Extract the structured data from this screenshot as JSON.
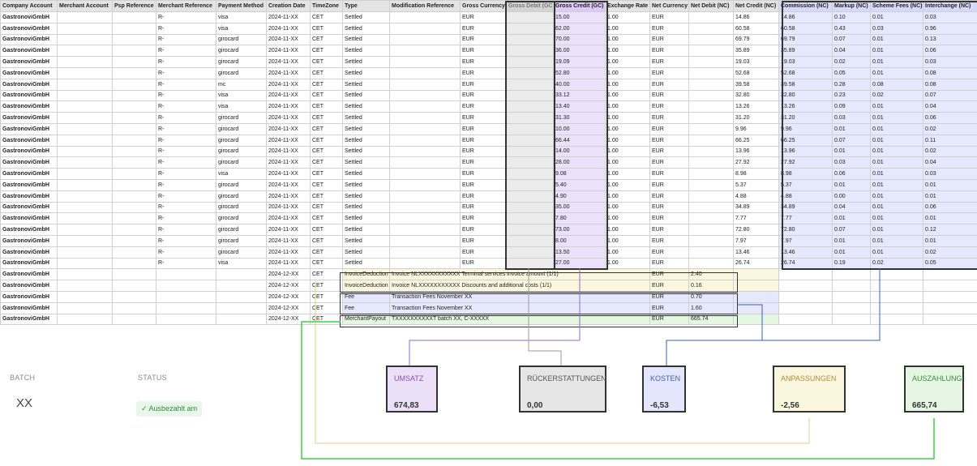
{
  "columns": [
    "Company Account",
    "Merchant Account",
    "Psp Reference",
    "Merchant Reference",
    "Payment Method",
    "Creation Date",
    "TimeZone",
    "Type",
    "Modification Reference",
    "Gross Currency",
    "Gross Debit (GC)",
    "Gross Credit (GC)",
    "Exchange Rate",
    "Net Currency",
    "Net Debit (NC)",
    "Net Credit (NC)",
    "Commission (NC)",
    "Markup (NC)",
    "Scheme Fees (NC)",
    "Interchange (NC)"
  ],
  "settled_rows": [
    [
      "GastronoviGmbH",
      "",
      "",
      "R-",
      "visa",
      "2024-11-XX",
      "CET",
      "Settled",
      "",
      "EUR",
      "",
      "15.00",
      "1.00",
      "EUR",
      "",
      "14.86",
      "0.10",
      "0.01",
      "0.03"
    ],
    [
      "GastronoviGmbH",
      "",
      "",
      "R-",
      "visa",
      "2024-11-XX",
      "CET",
      "Settled",
      "",
      "EUR",
      "",
      "62.00",
      "1.00",
      "EUR",
      "",
      "60.58",
      "0.43",
      "0.03",
      "0.96"
    ],
    [
      "GastronoviGmbH",
      "",
      "",
      "R-",
      "girocard",
      "2024-11-XX",
      "CET",
      "Settled",
      "",
      "EUR",
      "",
      "70.00",
      "1.00",
      "EUR",
      "",
      "69.79",
      "0.07",
      "0.01",
      "0.13"
    ],
    [
      "GastronoviGmbH",
      "",
      "",
      "R-",
      "girocard",
      "2024-11-XX",
      "CET",
      "Settled",
      "",
      "EUR",
      "",
      "36.00",
      "1.00",
      "EUR",
      "",
      "35.89",
      "0.04",
      "0.01",
      "0.06"
    ],
    [
      "GastronoviGmbH",
      "",
      "",
      "R-",
      "girocard",
      "2024-11-XX",
      "CET",
      "Settled",
      "",
      "EUR",
      "",
      "19.09",
      "1.00",
      "EUR",
      "",
      "19.03",
      "0.02",
      "0.01",
      "0.03"
    ],
    [
      "GastronoviGmbH",
      "",
      "",
      "R-",
      "girocard",
      "2024-11-XX",
      "CET",
      "Settled",
      "",
      "EUR",
      "",
      "52.80",
      "1.00",
      "EUR",
      "",
      "52.68",
      "0.05",
      "0.01",
      "0.08"
    ],
    [
      "GastronoviGmbH",
      "",
      "",
      "R-",
      "mc",
      "2024-11-XX",
      "CET",
      "Settled",
      "",
      "EUR",
      "",
      "40.00",
      "1.00",
      "EUR",
      "",
      "39.58",
      "0.28",
      "0.08",
      "0.08"
    ],
    [
      "GastronoviGmbH",
      "",
      "",
      "R-",
      "visa",
      "2024-11-XX",
      "CET",
      "Settled",
      "",
      "EUR",
      "",
      "33.12",
      "1.00",
      "EUR",
      "",
      "32.80",
      "0.23",
      "0.02",
      "0.07"
    ],
    [
      "GastronoviGmbH",
      "",
      "",
      "R-",
      "visa",
      "2024-11-XX",
      "CET",
      "Settled",
      "",
      "EUR",
      "",
      "13.40",
      "1.00",
      "EUR",
      "",
      "13.26",
      "0.09",
      "0.01",
      "0.04"
    ],
    [
      "GastronoviGmbH",
      "",
      "",
      "R-",
      "girocard",
      "2024-11-XX",
      "CET",
      "Settled",
      "",
      "EUR",
      "",
      "31.30",
      "1.00",
      "EUR",
      "",
      "31.20",
      "0.03",
      "0.01",
      "0.06"
    ],
    [
      "GastronoviGmbH",
      "",
      "",
      "R-",
      "girocard",
      "2024-11-XX",
      "CET",
      "Settled",
      "",
      "EUR",
      "",
      "10.00",
      "1.00",
      "EUR",
      "",
      "9.96",
      "0.01",
      "0.01",
      "0.02"
    ],
    [
      "GastronoviGmbH",
      "",
      "",
      "R-",
      "girocard",
      "2024-11-XX",
      "CET",
      "Settled",
      "",
      "EUR",
      "",
      "66.44",
      "1.00",
      "EUR",
      "",
      "66.25",
      "0.07",
      "0.01",
      "0.11"
    ],
    [
      "GastronoviGmbH",
      "",
      "",
      "R-",
      "girocard",
      "2024-11-XX",
      "CET",
      "Settled",
      "",
      "EUR",
      "",
      "14.00",
      "1.00",
      "EUR",
      "",
      "13.96",
      "0.01",
      "0.01",
      "0.02"
    ],
    [
      "GastronoviGmbH",
      "",
      "",
      "R-",
      "girocard",
      "2024-11-XX",
      "CET",
      "Settled",
      "",
      "EUR",
      "",
      "28.00",
      "1.00",
      "EUR",
      "",
      "27.92",
      "0.03",
      "0.01",
      "0.04"
    ],
    [
      "GastronoviGmbH",
      "",
      "",
      "R-",
      "visa",
      "2024-11-XX",
      "CET",
      "Settled",
      "",
      "EUR",
      "",
      "9.08",
      "1.00",
      "EUR",
      "",
      "8.98",
      "0.06",
      "0.01",
      "0.03"
    ],
    [
      "GastronoviGmbH",
      "",
      "",
      "R-",
      "girocard",
      "2024-11-XX",
      "CET",
      "Settled",
      "",
      "EUR",
      "",
      "5.40",
      "1.00",
      "EUR",
      "",
      "5.37",
      "0.01",
      "0.01",
      "0.01"
    ],
    [
      "GastronoviGmbH",
      "",
      "",
      "R-",
      "girocard",
      "2024-11-XX",
      "CET",
      "Settled",
      "",
      "EUR",
      "",
      "4.90",
      "1.00",
      "EUR",
      "",
      "4.88",
      "0.00",
      "0.01",
      "0.01"
    ],
    [
      "GastronoviGmbH",
      "",
      "",
      "R-",
      "girocard",
      "2024-11-XX",
      "CET",
      "Settled",
      "",
      "EUR",
      "",
      "35.00",
      "1.00",
      "EUR",
      "",
      "34.89",
      "0.04",
      "0.01",
      "0.06"
    ],
    [
      "GastronoviGmbH",
      "",
      "",
      "R-",
      "girocard",
      "2024-11-XX",
      "CET",
      "Settled",
      "",
      "EUR",
      "",
      "7.80",
      "1.00",
      "EUR",
      "",
      "7.77",
      "0.01",
      "0.01",
      "0.01"
    ],
    [
      "GastronoviGmbH",
      "",
      "",
      "R-",
      "girocard",
      "2024-11-XX",
      "CET",
      "Settled",
      "",
      "EUR",
      "",
      "73.00",
      "1.00",
      "EUR",
      "",
      "72.80",
      "0.07",
      "0.01",
      "0.12"
    ],
    [
      "GastronoviGmbH",
      "",
      "",
      "R-",
      "girocard",
      "2024-11-XX",
      "CET",
      "Settled",
      "",
      "EUR",
      "",
      "8.00",
      "1.00",
      "EUR",
      "",
      "7.97",
      "0.01",
      "0.01",
      "0.01"
    ],
    [
      "GastronoviGmbH",
      "",
      "",
      "R-",
      "girocard",
      "2024-11-XX",
      "CET",
      "Settled",
      "",
      "EUR",
      "",
      "13.50",
      "1.00",
      "EUR",
      "",
      "13.46",
      "0.01",
      "0.01",
      "0.02"
    ],
    [
      "GastronoviGmbH",
      "",
      "",
      "R-",
      "visa",
      "2024-11-XX",
      "CET",
      "Settled",
      "",
      "EUR",
      "",
      "27.00",
      "1.00",
      "EUR",
      "",
      "26.74",
      "0.19",
      "0.02",
      "0.05"
    ]
  ],
  "adjustment_rows": [
    {
      "company": "GastronoviGmbH",
      "date": "2024-12-XX",
      "tz": "CET",
      "type": "InvoiceDeduction",
      "ref": "Invoice NLXXXXXXXXXXX Terminal services invoice amount (1/1)",
      "currency": "EUR",
      "debit": "2.40",
      "credit": "",
      "kind": "inv"
    },
    {
      "company": "GastronoviGmbH",
      "date": "2024-12-XX",
      "tz": "CET",
      "type": "InvoiceDeduction",
      "ref": "Invoice NLXXXXXXXXXXX Discounts and additional costs (1/1)",
      "currency": "EUR",
      "debit": "0.16",
      "credit": "",
      "kind": "inv"
    },
    {
      "company": "GastronoviGmbH",
      "date": "2024-12-XX",
      "tz": "CET",
      "type": "Fee",
      "ref": "Transaction Fees November XX",
      "currency": "EUR",
      "debit": "0.70",
      "credit": "",
      "kind": "fee"
    },
    {
      "company": "GastronoviGmbH",
      "date": "2024-12-XX",
      "tz": "CET",
      "type": "Fee",
      "ref": "Transaction Fees November XX",
      "currency": "EUR",
      "debit": "1.60",
      "credit": "",
      "kind": "fee"
    },
    {
      "company": "GastronoviGmbH",
      "date": "2024-12-XX",
      "tz": "CET",
      "type": "MerchantPayout",
      "ref": "TXXXXXXXXXXT batch XX, C-XXXXX",
      "currency": "EUR",
      "debit": "665.74",
      "credit": "",
      "kind": "payout"
    }
  ],
  "batch": {
    "label": "BATCH",
    "value": "XX"
  },
  "status": {
    "label": "STATUS",
    "value": "✓ Ausbezahlt am"
  },
  "summary": [
    {
      "key": "umsatz",
      "title": "UMSATZ",
      "value": "674,83",
      "bg": "#ecdff8",
      "color": "#8a4fb8"
    },
    {
      "key": "rueckerstattungen",
      "title": "RÜCKERSTATTUNGEN",
      "value": "0,00",
      "bg": "#e6e6e6",
      "color": "#555555"
    },
    {
      "key": "kosten",
      "title": "KOSTEN",
      "value": "-6,53",
      "bg": "#e3e6fc",
      "color": "#4a5bb8"
    },
    {
      "key": "anpassungen",
      "title": "ANPASSUNGEN",
      "value": "-2,56",
      "bg": "#fbf7df",
      "color": "#b08a3a"
    },
    {
      "key": "auszahlung",
      "title": "AUSZAHLUNG",
      "value": "665,74",
      "bg": "#e5f7e3",
      "color": "#3b8a3b"
    }
  ]
}
